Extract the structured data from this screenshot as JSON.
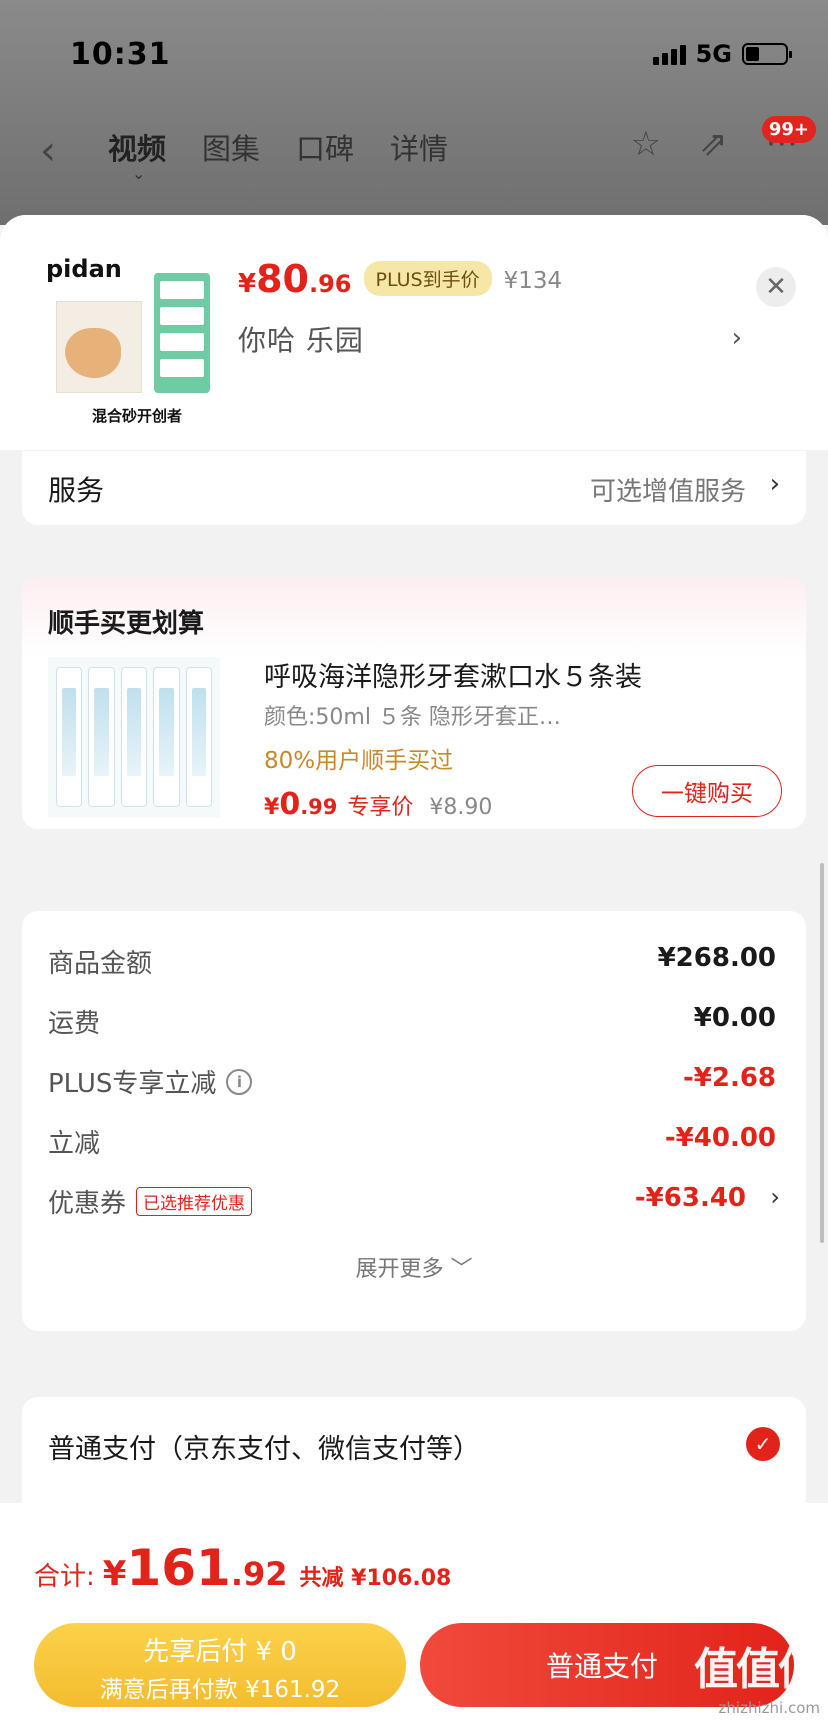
{
  "status_bar": {
    "time": "10:31",
    "network": "5G"
  },
  "nav": {
    "tabs": [
      "视频",
      "图集",
      "口碑",
      "详情"
    ],
    "badge": "99+"
  },
  "product": {
    "brand": "pidan",
    "image_caption": "混合砂开创者",
    "price_symbol": "¥",
    "price_int": "80",
    "price_dec": ".96",
    "plus_tag": "PLUS到手价",
    "original_price": "¥134",
    "variant": "你哈  乐园"
  },
  "service": {
    "label": "服务",
    "value": "可选增值服务"
  },
  "addon": {
    "title": "顺手买更划算",
    "name": "呼吸海洋隐形牙套漱口水５条装",
    "spec": "颜色:50ml ５条 隐形牙套正…",
    "stat": "80%用户顺手买过",
    "price_symbol": "¥",
    "price_int": "0",
    "price_dec": ".99",
    "price_tag": "专享价",
    "original_price": "¥8.90",
    "buy_label": "一键购买"
  },
  "amounts": {
    "rows": [
      {
        "label": "商品金额",
        "value": "¥268.00"
      },
      {
        "label": "运费",
        "value": "¥0.00"
      },
      {
        "label": "PLUS专享立减",
        "value": "-¥2.68"
      },
      {
        "label": "立减",
        "value": "-¥40.00"
      },
      {
        "label": "优惠券",
        "value": "-¥63.40",
        "tag": "已选推荐优惠"
      }
    ],
    "expand_label": "展开更多 ﹀"
  },
  "payment": {
    "label": "普通支付（京东支付、微信支付等）"
  },
  "bottom": {
    "total_label": "合计:",
    "total_symbol": "¥",
    "total_int": "161",
    "total_dec": ".92",
    "saved": "共减 ¥106.08",
    "later_line1": "先享后付 ¥ 0",
    "later_line2": "满意后再付款 ¥161.92",
    "pay_label": "普通支付",
    "watermark_big": "值值值",
    "watermark_small": "zhizhizhi.com"
  },
  "colors": {
    "accent": "#e2231a",
    "gold": "#f4bc2f"
  }
}
